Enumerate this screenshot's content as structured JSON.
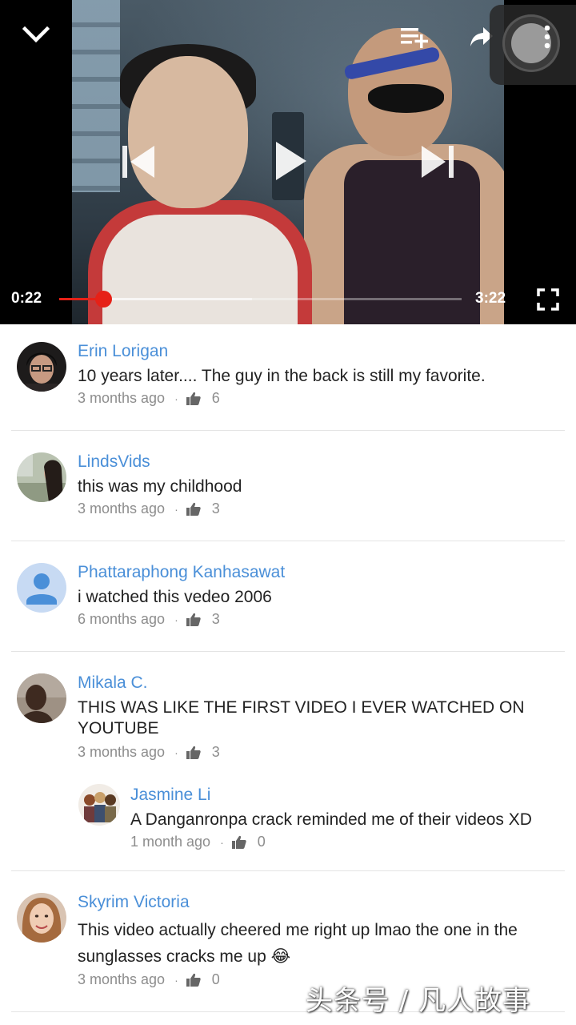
{
  "player": {
    "current_time": "0:22",
    "total_time": "3:22",
    "progress_fraction": 0.109,
    "buffered_fraction": 0.48,
    "accent_color": "#e62117"
  },
  "comments": [
    {
      "author": "Erin Lorigan",
      "text": "10 years later.... The guy in the back is still my favorite.",
      "time": "3 months ago",
      "likes": "6"
    },
    {
      "author": "LindsVids",
      "text": "this was my childhood",
      "time": "3 months ago",
      "likes": "3"
    },
    {
      "author": "Phattaraphong Kanhasawat",
      "text": "i watched this vedeo 2006",
      "time": "6 months ago",
      "likes": "3"
    },
    {
      "author": "Mikala C.",
      "text": "THIS WAS LIKE THE FIRST VIDEO I EVER WATCHED ON YOUTUBE",
      "time": "3 months ago",
      "likes": "3",
      "reply": {
        "author": "Jasmine Li",
        "text": "A Danganronpa crack reminded me of their videos XD",
        "time": "1 month ago",
        "likes": "0"
      }
    },
    {
      "author": "Skyrim Victoria",
      "text": "This video actually cheered me right up lmao the one in the sunglasses cracks me up 😂",
      "time": "3 months ago",
      "likes": "0"
    }
  ],
  "meta_separator": "·",
  "watermark": "头条号 / 凡人故事",
  "icons": {
    "collapse": "chevron-down-icon",
    "add_to_playlist": "playlist-add-icon",
    "share": "share-icon",
    "more": "more-vert-icon",
    "previous": "skip-previous-icon",
    "play": "play-icon",
    "next": "skip-next-icon",
    "fullscreen": "fullscreen-icon",
    "like": "thumb-up-icon"
  },
  "colors": {
    "author_link": "#4a8fd8",
    "meta_text": "#8d8d8d"
  }
}
